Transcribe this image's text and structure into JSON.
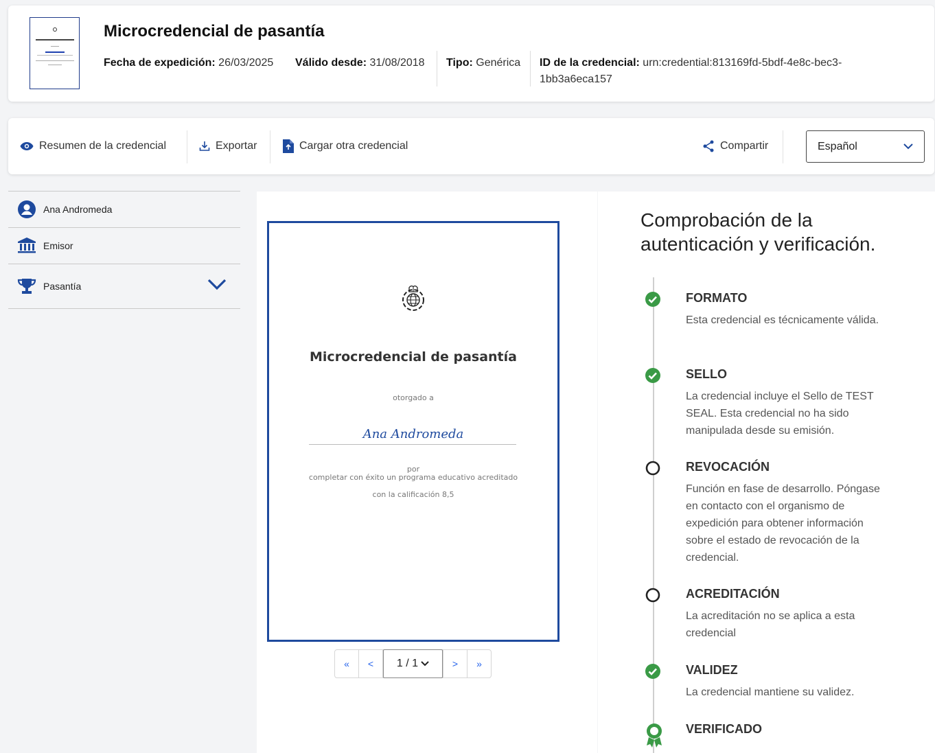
{
  "header": {
    "title": "Microcredencial de pasantía",
    "issue_label": "Fecha de expedición:",
    "issue_value": "26/03/2025",
    "valid_label": "Válido desde:",
    "valid_value": "31/08/2018",
    "type_label": "Tipo:",
    "type_value": "Genérica",
    "id_label": "ID de la credencial:",
    "id_value": "urn:credential:813169fd-5bdf-4e8c-bec3-1bb3a6eca157"
  },
  "toolbar": {
    "summary_label": "Resumen de la credencial",
    "export_label": "Exportar",
    "upload_label": "Cargar otra credencial",
    "share_label": "Compartir",
    "language_value": "Español"
  },
  "sidebar": {
    "items": [
      {
        "label": "Ana Andromeda",
        "icon": "user-circle-icon"
      },
      {
        "label": "Emisor",
        "icon": "institution-icon"
      },
      {
        "label": "Pasantía",
        "icon": "trophy-icon"
      }
    ]
  },
  "document": {
    "title": "Microcredencial de pasantía",
    "awarded_to": "otorgado a",
    "recipient": "Ana Andromeda",
    "por": "por",
    "reason": "completar con éxito un programa educativo acreditado",
    "grade": "con la calificación 8,5"
  },
  "pager": {
    "first": "«",
    "prev": "<",
    "current": "1 / 1",
    "next": ">",
    "last": "»"
  },
  "verification": {
    "title": "Comprobación de la autenticación y verificación.",
    "steps": [
      {
        "name": "FORMATO",
        "status": "ok",
        "desc": "Esta credencial es técnicamente válida."
      },
      {
        "name": "SELLO",
        "status": "ok",
        "desc": "La credencial incluye el Sello de TEST SEAL. Esta credencial no ha sido manipulada desde su emisión."
      },
      {
        "name": "REVOCACIÓN",
        "status": "pending",
        "desc": "Función en fase de desarrollo. Póngase en contacto con el organismo de expedición para obtener información sobre el estado de revocación de la credencial."
      },
      {
        "name": "ACREDITACIÓN",
        "status": "pending",
        "desc": "La acreditación no se aplica a esta credencial"
      },
      {
        "name": "VALIDEZ",
        "status": "ok",
        "desc": "La credencial mantiene su validez."
      },
      {
        "name": "VERIFICADO",
        "status": "verified",
        "desc": ""
      }
    ]
  },
  "colors": {
    "primary": "#1e4a9e",
    "success": "#3a9a46",
    "link": "#2563eb"
  }
}
